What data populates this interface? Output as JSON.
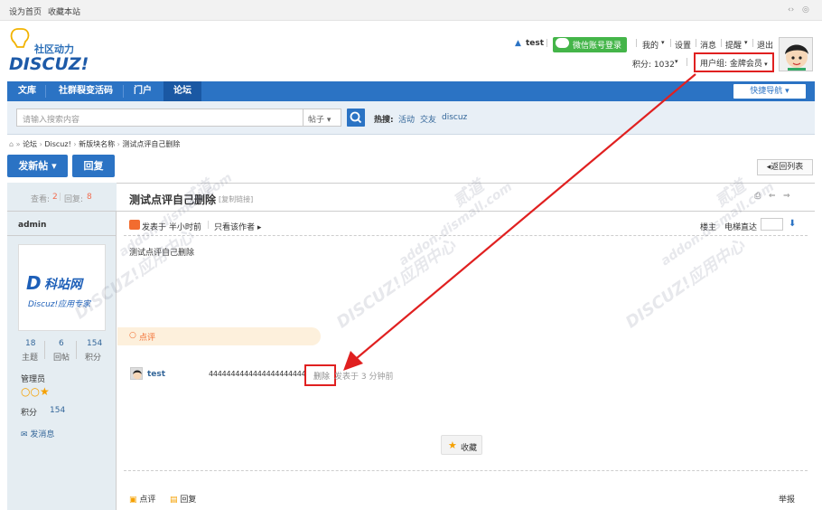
{
  "topbar": {
    "set_home": "设为首页",
    "favorite_site": "收藏本站"
  },
  "logo": {
    "slogan": "社区动力",
    "brand": "DISCUZ!"
  },
  "user": {
    "name": "test",
    "wechat_login": "微信账号登录",
    "my": "我的",
    "settings": "设置",
    "messages": "消息",
    "reminders": "提醒",
    "logout": "退出",
    "points": "积分: 1032",
    "usergroup": "用户组: 金牌会员"
  },
  "nav": {
    "items": [
      "文库",
      "社群裂变活码",
      "门户",
      "论坛"
    ],
    "quick_nav": "快捷导航"
  },
  "search": {
    "placeholder": "请输入搜索内容",
    "type": "帖子",
    "hot_label": "热搜:",
    "hot_terms": [
      "活动",
      "交友",
      "discuz"
    ]
  },
  "breadcrumb": [
    "论坛",
    "Discuz!",
    "新版块名称",
    "测试点评自己删除"
  ],
  "actions": {
    "new_post": "发新帖",
    "reply": "回复",
    "back_list": "返回列表"
  },
  "thread": {
    "views_label": "查看:",
    "views": "2",
    "replies_label": "回复:",
    "replies": "8",
    "title": "测试点评自己删除",
    "copy_link": "[复制链接]",
    "author": "admin",
    "posted": "发表于 半小时前",
    "only_author": "只看该作者",
    "floor": "楼主",
    "goto_floor": "电梯直达",
    "content": "测试点评自己删除"
  },
  "author_card": {
    "logo_text": "科站网",
    "logo_sub": "Discuz!应用专家",
    "stats": [
      {
        "value": "18",
        "label": "主题"
      },
      {
        "value": "6",
        "label": "回帖"
      },
      {
        "value": "154",
        "label": "积分"
      }
    ],
    "role": "管理员",
    "points_label": "积分",
    "points_value": "154",
    "send_message": "发消息"
  },
  "comment": {
    "header": "点评",
    "user": "test",
    "text": "4444444444444444444444",
    "delete": "删除",
    "time": "发表于 3 分钟前"
  },
  "footer": {
    "favorite": "收藏",
    "rate": "点评",
    "reply": "回复",
    "report": "举报"
  },
  "watermarks": [
    "DISCUZ!应用中心",
    "addon.dismall.com",
    "贰道"
  ],
  "colors": {
    "nav_blue": "#2b73c4",
    "annotation_red": "#e02020",
    "wechat_green": "#44b549"
  }
}
